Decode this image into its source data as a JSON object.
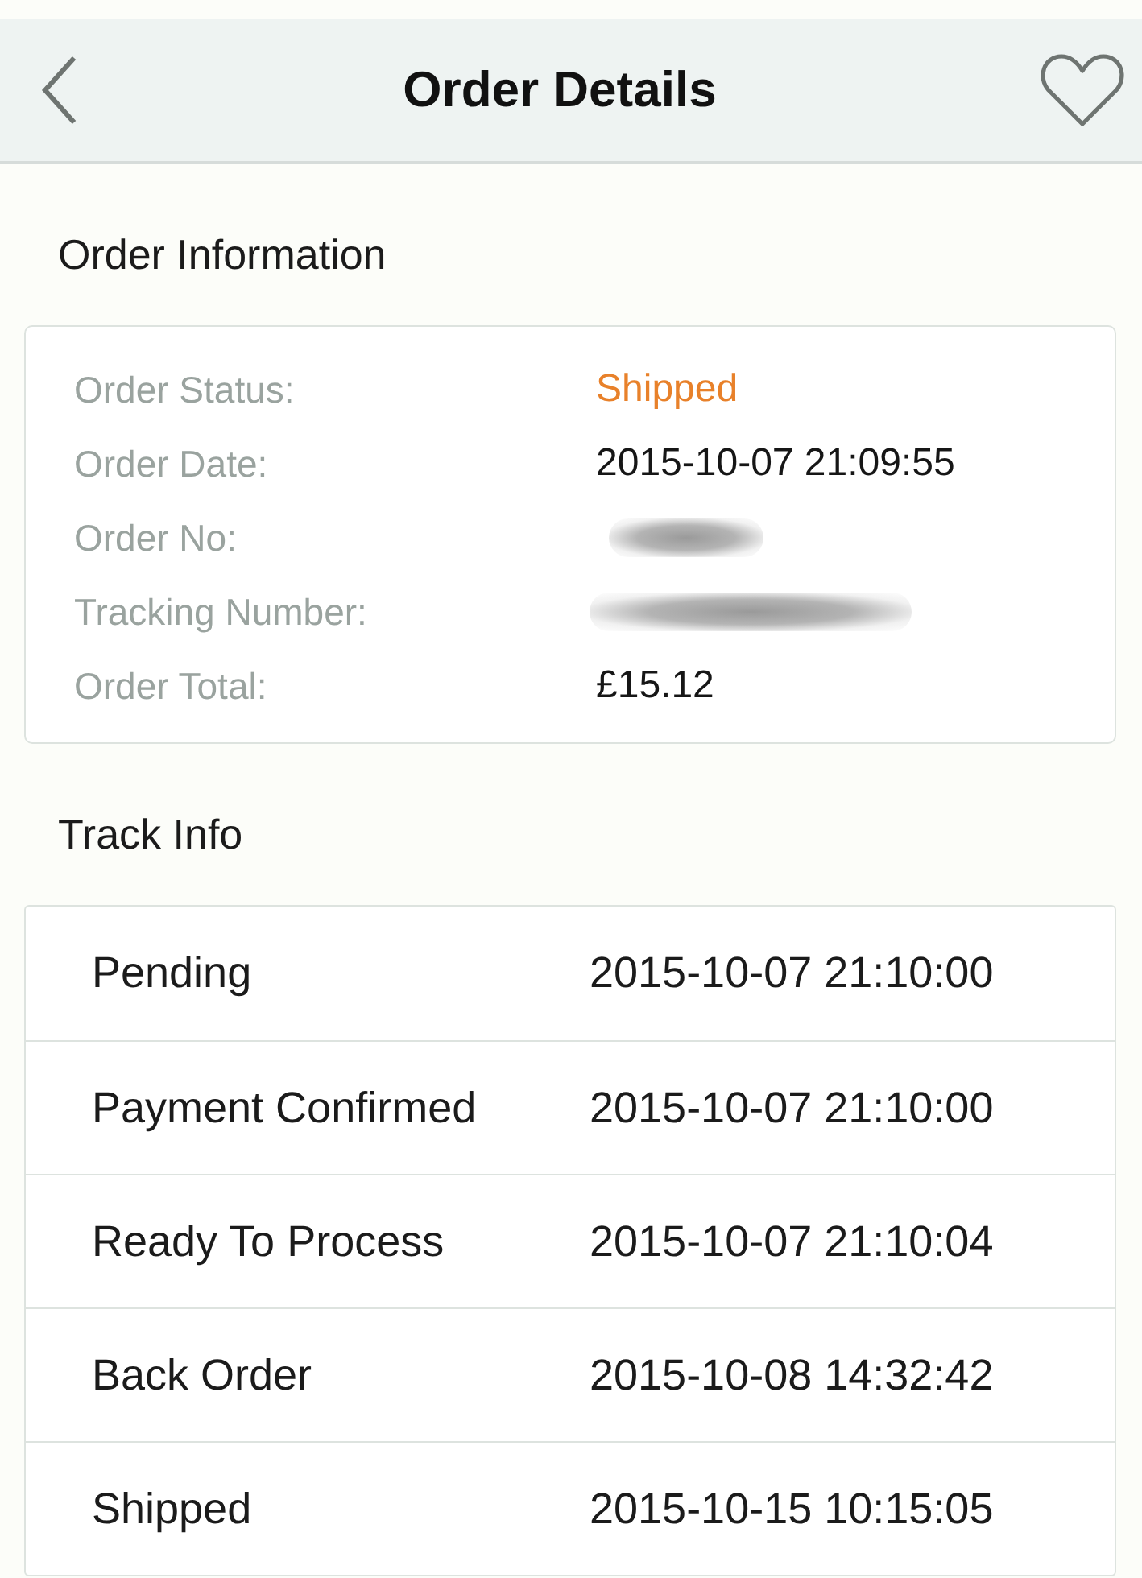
{
  "header": {
    "title": "Order Details"
  },
  "order_information": {
    "heading": "Order Information",
    "rows": [
      {
        "label": "Order Status:",
        "value": "Shipped",
        "kind": "status"
      },
      {
        "label": "Order Date:",
        "value": "2015-10-07 21:09:55",
        "kind": "text"
      },
      {
        "label": "Order No:",
        "kind": "redacted"
      },
      {
        "label": "Tracking Number:",
        "kind": "redacted-wide"
      },
      {
        "label": "Order Total:",
        "value": "£15.12",
        "kind": "text"
      }
    ]
  },
  "track_info": {
    "heading": "Track Info",
    "events": [
      {
        "status": "Pending",
        "time": "2015-10-07 21:10:00"
      },
      {
        "status": "Payment Confirmed",
        "time": "2015-10-07 21:10:00"
      },
      {
        "status": "Ready To Process",
        "time": "2015-10-07 21:10:04"
      },
      {
        "status": "Back Order",
        "time": "2015-10-08 14:32:42"
      },
      {
        "status": "Shipped",
        "time": "2015-10-15 10:15:05"
      }
    ]
  }
}
